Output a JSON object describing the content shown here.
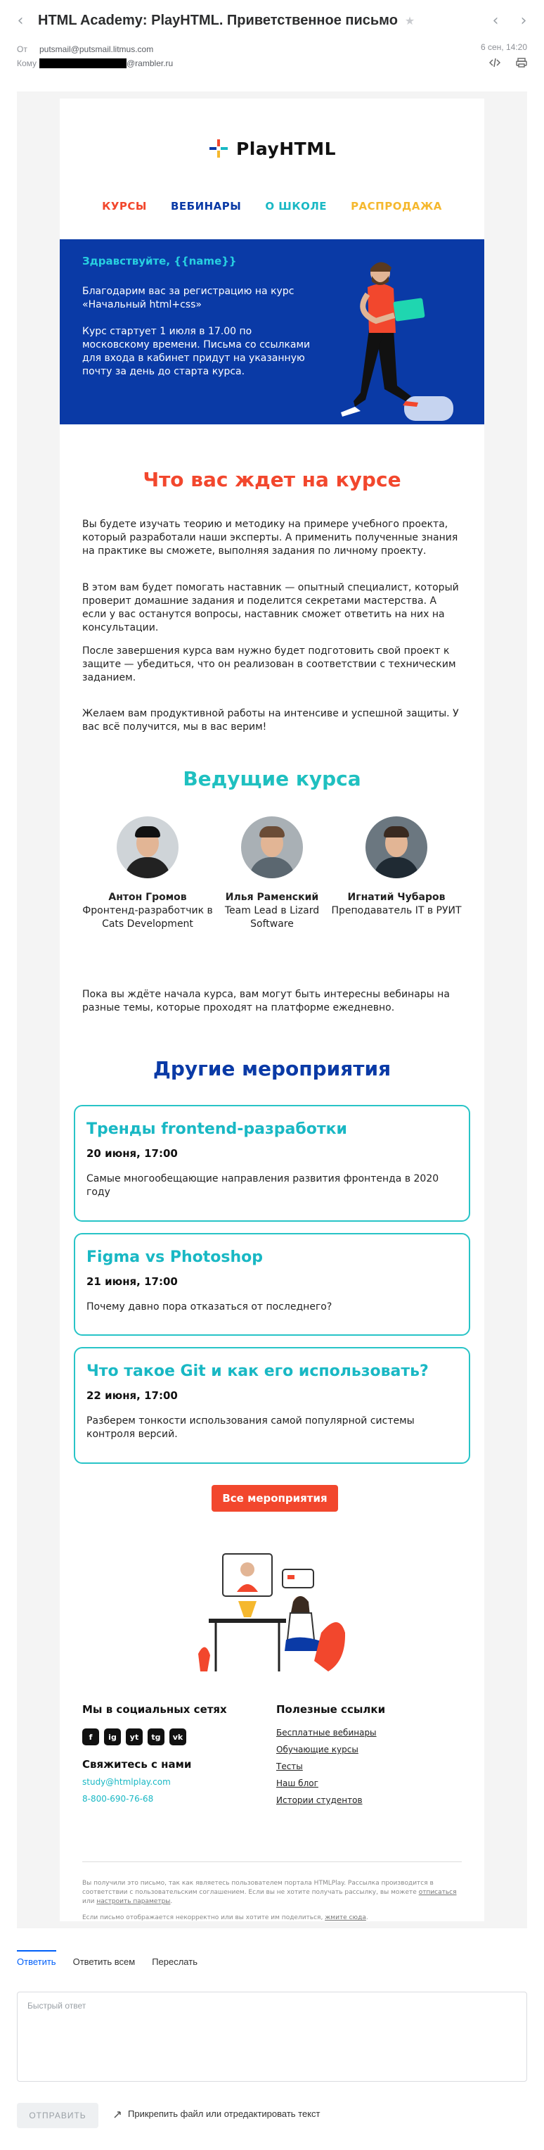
{
  "header": {
    "subject": "HTML Academy: PlayHTML. Приветственное письмо",
    "from_label": "От",
    "from_value": "putsmail@putsmail.litmus.com",
    "to_label": "Кому",
    "to_suffix": "@rambler.ru",
    "date": "6 сен, 14:20",
    "icons": [
      "back-icon",
      "star-icon",
      "prev-icon",
      "next-icon",
      "code-icon",
      "print-icon"
    ]
  },
  "email": {
    "logo": "PlayHTML",
    "menu": [
      {
        "label": "КУРСЫ",
        "color": "#f2472d"
      },
      {
        "label": "ВЕБИНАРЫ",
        "color": "#0a3aa6"
      },
      {
        "label": "О ШКОЛЕ",
        "color": "#19b8c4"
      },
      {
        "label": "РАСПРОДАЖА",
        "color": "#f5b82e"
      }
    ],
    "hero": {
      "hello": "Здравствуйте, {{name}}",
      "p1": "Благодарим вас за регистрацию на курс «Начальный html+css»",
      "p2": "Курс стартует 1 июля в 17.00 по московскому времени. Письма со ссылками для входа в кабинет придут на указанную почту за день до старта курса."
    },
    "what_title": "Что вас ждет на курсе",
    "paragraphs": [
      "Вы будете изучать теорию и методику на примере учебного проекта, который разработали наши эксперты. А применить полученные знания на практике вы сможете, выполняя задания по личному проекту.",
      "В этом вам будет помогать наставник — опытный специалист, который проверит домашние задания и поделится секретами мастерства. А если у вас останутся вопросы, наставник сможет ответить на них на консультации.",
      "После завершения курса вам нужно будет подготовить свой проект к защите — убедиться, что он реализован в соответствии с техническим заданием.",
      "Желаем вам продуктивной работы на интенсиве и успешной защиты. У вас всё получится, мы в вас верим!"
    ],
    "mentors_title": "Ведущие курса",
    "mentors": [
      {
        "name": "Антон Громов",
        "role": "Фронтенд-разработчик в Cats Development"
      },
      {
        "name": "Илья Раменский",
        "role": "Team Lead в Lizard Software"
      },
      {
        "name": "Игнатий Чубаров",
        "role": "Преподаватель IT в РУИТ"
      }
    ],
    "webinar_intro": "Пока вы ждёте начала курса, вам могут быть интересны вебинары на разные темы, которые проходят на платформе ежедневно.",
    "events_title": "Другие мероприятия",
    "events": [
      {
        "title": "Тренды frontend-разработки",
        "date": "20 июня, 17:00",
        "desc": "Самые многообещающие направления развития фронтенда в 2020 году"
      },
      {
        "title": "Figma vs Photoshop",
        "date": "21 июня, 17:00",
        "desc": "Почему давно пора отказаться от последнего?"
      },
      {
        "title": "Что такое Git и как его использовать?",
        "date": "22 июня, 17:00",
        "desc": "Разберем тонкости использования самой популярной системы контроля версий."
      }
    ],
    "cta": "Все мероприятия",
    "social_title": "Мы в социальных сетях",
    "social": [
      "f",
      "ig",
      "yt",
      "tg",
      "vk"
    ],
    "contact_title": "Свяжитесь с нами",
    "contact_email": "study@htmlplay.com",
    "contact_phone": "8-800-690-76-68",
    "links_title": "Полезные ссылки",
    "links": [
      "Бесплатные вебинары",
      "Обучающие курсы",
      "Тесты",
      "Наш блог",
      "Истории студентов"
    ],
    "fine1": "Вы получили это письмо, так как являетесь пользователем портала HTMLPlay. Рассылка производится в соответствии с пользовательским соглашением. Если вы не хотите получать рассылку, вы можете ",
    "fine1_link1": "отписаться",
    "fine1_mid": " или ",
    "fine1_link2": "настроить параметры",
    "fine1_end": ".",
    "fine2": "Если письмо отображается некорректно или вы хотите им поделиться, ",
    "fine2_link": "жмите сюда",
    "fine2_end": "."
  },
  "reply": {
    "tabs": [
      "Ответить",
      "Ответить всем",
      "Переслать"
    ],
    "placeholder": "Быстрый ответ",
    "send": "ОТПРАВИТЬ",
    "attach": "Прикрепить файл или отредактировать текст"
  }
}
